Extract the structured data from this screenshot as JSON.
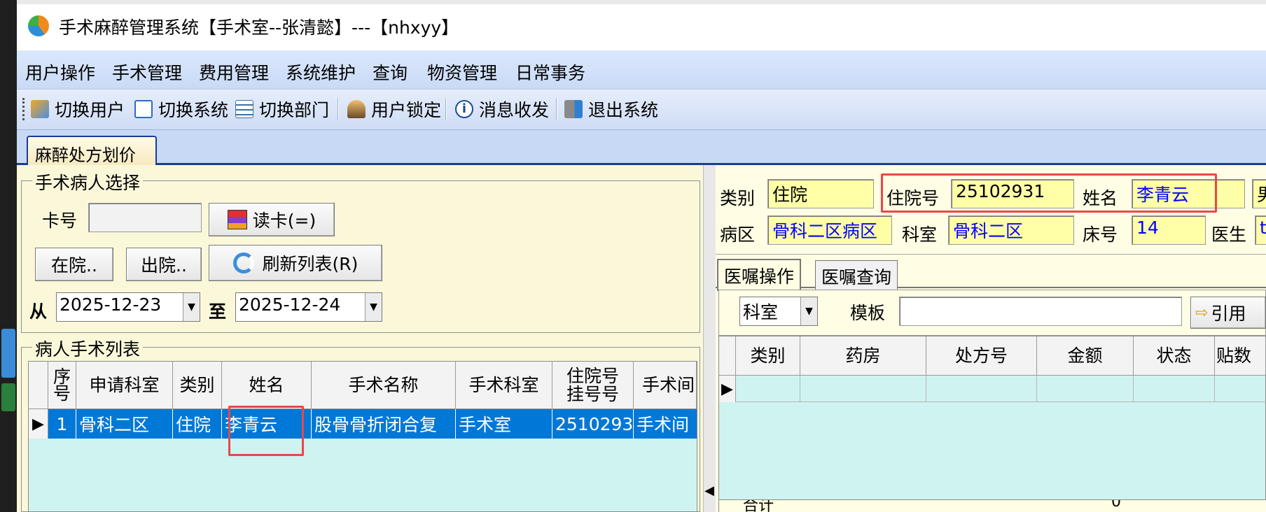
{
  "window": {
    "title": "手术麻醉管理系统【手术室--张清懿】---【nhxyy】"
  },
  "menu": [
    "用户操作",
    "手术管理",
    "费用管理",
    "系统维护",
    "查询",
    "物资管理",
    "日常事务"
  ],
  "toolbar": [
    "切换用户",
    "切换系统",
    "切换部门",
    "用户锁定",
    "消息收发",
    "退出系统"
  ],
  "tab": "麻醉处方划价",
  "patient_select": {
    "legend": "手术病人选择",
    "card_label": "卡号",
    "card_value": "",
    "read_card": "读卡(=)",
    "in_hospital": "在院..",
    "discharged": "出院..",
    "refresh": "刷新列表(R)",
    "from_label": "从",
    "from_date": "2025-12-23",
    "to_label": "至",
    "to_date": "2025-12-24"
  },
  "surgery_list": {
    "legend": "病人手术列表",
    "columns": [
      "序号",
      "申请科室",
      "类别",
      "姓名",
      "手术名称",
      "手术科室",
      "住院号挂号号",
      "手术间"
    ],
    "rows": [
      {
        "seq": "1",
        "dept": "骨科二区",
        "type": "住院",
        "name": "李青云",
        "surgery": "股骨骨折闭合复",
        "op_dept": "手术室",
        "admission": "2510293",
        "room": "手术间"
      }
    ]
  },
  "patient_info": {
    "category_label": "类别",
    "category": "住院",
    "admission_label": "住院号",
    "admission": "25102931",
    "name_label": "姓名",
    "name": "李青云",
    "sex": "男",
    "ward_label": "病区",
    "ward": "骨科二区病区",
    "dept_label": "科室",
    "dept": "骨科二区",
    "bed_label": "床号",
    "bed": "14",
    "doctor_label": "医生",
    "doctor": "t"
  },
  "order_tabs": [
    "医嘱操作",
    "医嘱查询"
  ],
  "order_ops": {
    "dept_select": "科室",
    "template_label": "模板",
    "template_value": "",
    "cite": "引用"
  },
  "order_grid": {
    "columns": [
      "类别",
      "药房",
      "处方号",
      "金额",
      "状态",
      "贴数"
    ],
    "footer_label": "合计",
    "footer_amount": "0"
  }
}
